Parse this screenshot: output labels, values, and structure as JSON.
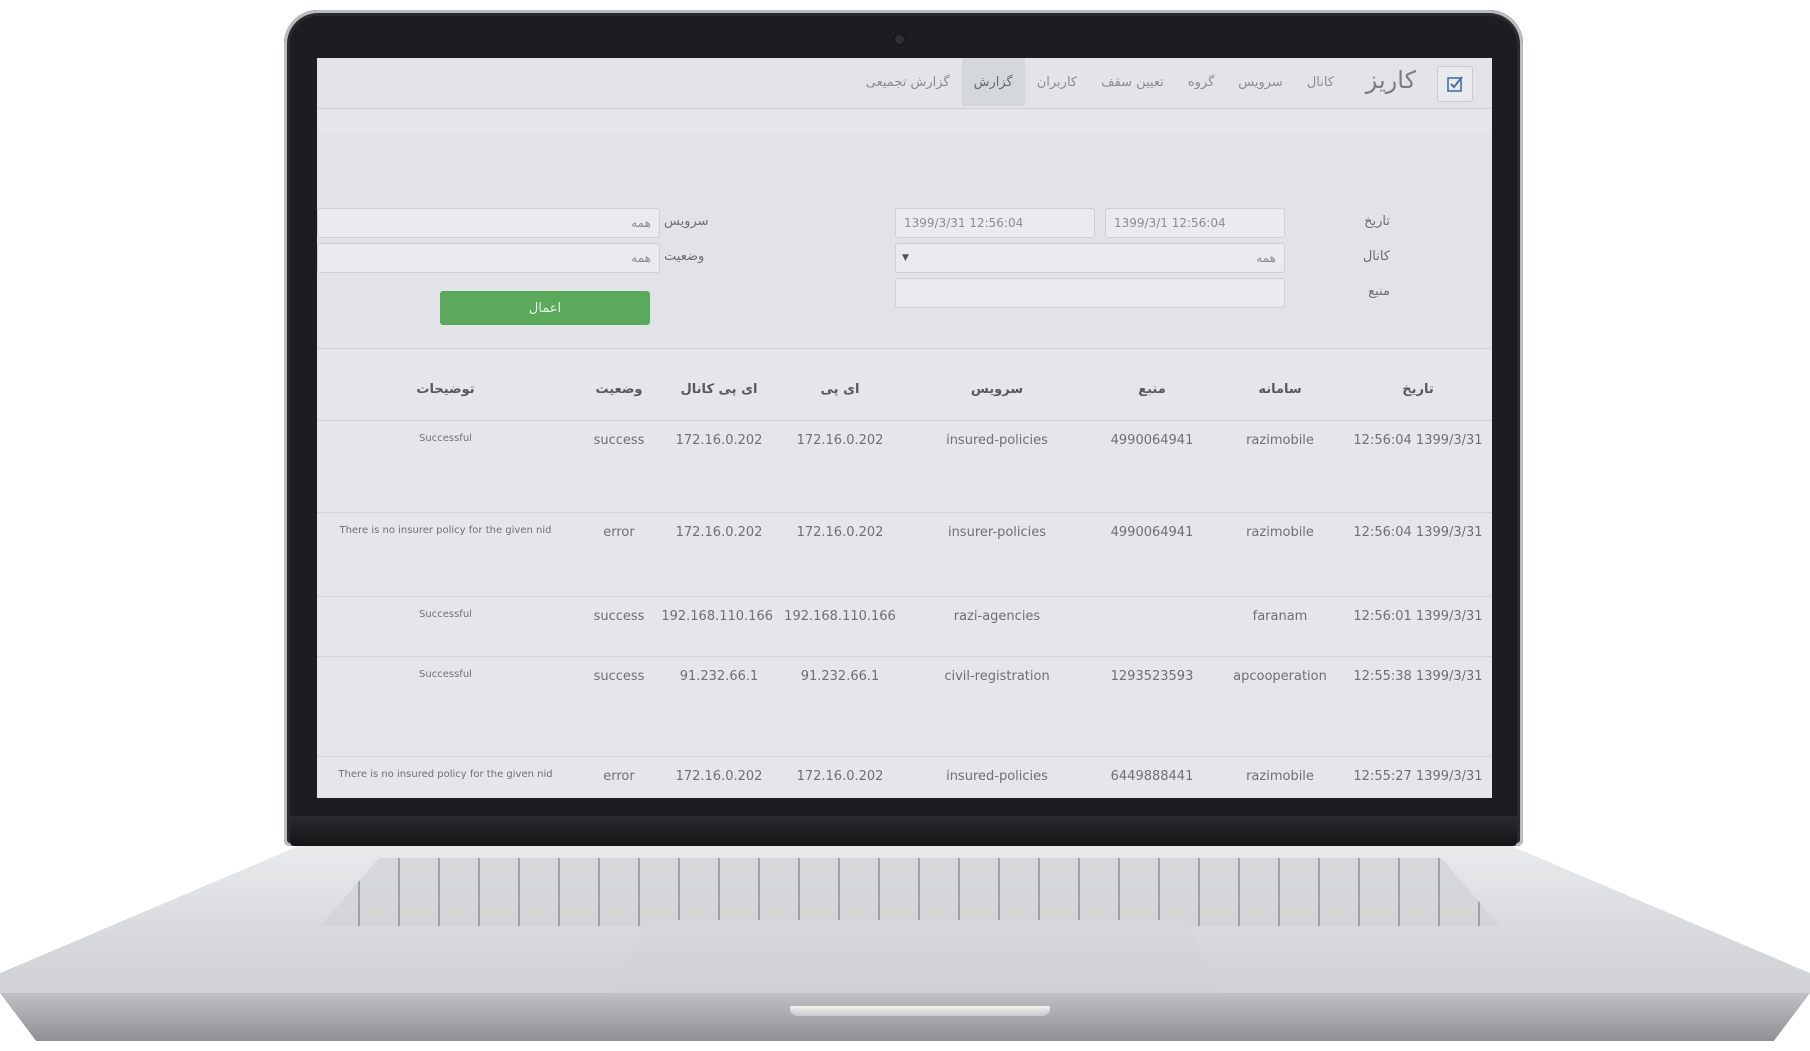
{
  "app": {
    "brand": "کاریز",
    "nav": [
      "کانال",
      "سرویس",
      "گروه",
      "تعیین سقف",
      "کاربران",
      "گزارش",
      "گزارش تجمیعی"
    ],
    "active_nav": "گزارش"
  },
  "filters": {
    "date_label": "تاریخ",
    "date_from": "1399/3/1 12:56:04",
    "date_to": "1399/3/31 12:56:04",
    "channel_label": "کانال",
    "channel_value": "همه",
    "source_label": "منبع",
    "source_value": "",
    "service_label": "سرویس",
    "service_value": "همه",
    "status_label": "وضعیت",
    "status_value": "همه",
    "apply_label": "اعمال"
  },
  "table": {
    "headers": [
      "تاریخ",
      "سامانه",
      "منبع",
      "سرویس",
      "ای پی",
      "ای پی کانال",
      "وضعیت",
      "توضیحات"
    ],
    "rows": [
      [
        "12:56:04 1399/3/31",
        "razimobile",
        "4990064941",
        "insured-policies",
        "172.16.0.202",
        "172.16.0.202",
        "success",
        "Successful"
      ],
      [
        "12:56:04 1399/3/31",
        "razimobile",
        "4990064941",
        "insurer-policies",
        "172.16.0.202",
        "172.16.0.202",
        "error",
        "There is no insurer policy for the given nid"
      ],
      [
        "12:56:01 1399/3/31",
        "faranam",
        "",
        "razi-agencies",
        "192.168.110.166",
        "192.168.110.166",
        "success",
        "Successful"
      ],
      [
        "12:55:38 1399/3/31",
        "apcooperation",
        "1293523593",
        "civil-registration",
        "91.232.66.1",
        "91.232.66.1",
        "success",
        "Successful"
      ],
      [
        "12:55:27 1399/3/31",
        "razimobile",
        "6449888441",
        "insured-policies",
        "172.16.0.202",
        "172.16.0.202",
        "error",
        "There is no insured policy for the given nid"
      ]
    ]
  },
  "icons": {
    "logo": "checkbox-logo-icon",
    "dropdown": "caret-down-icon"
  },
  "colors": {
    "apply_button": "#5aa95c",
    "active_tab": "#d5d8db",
    "screen_bg": "#e4e6e9"
  }
}
